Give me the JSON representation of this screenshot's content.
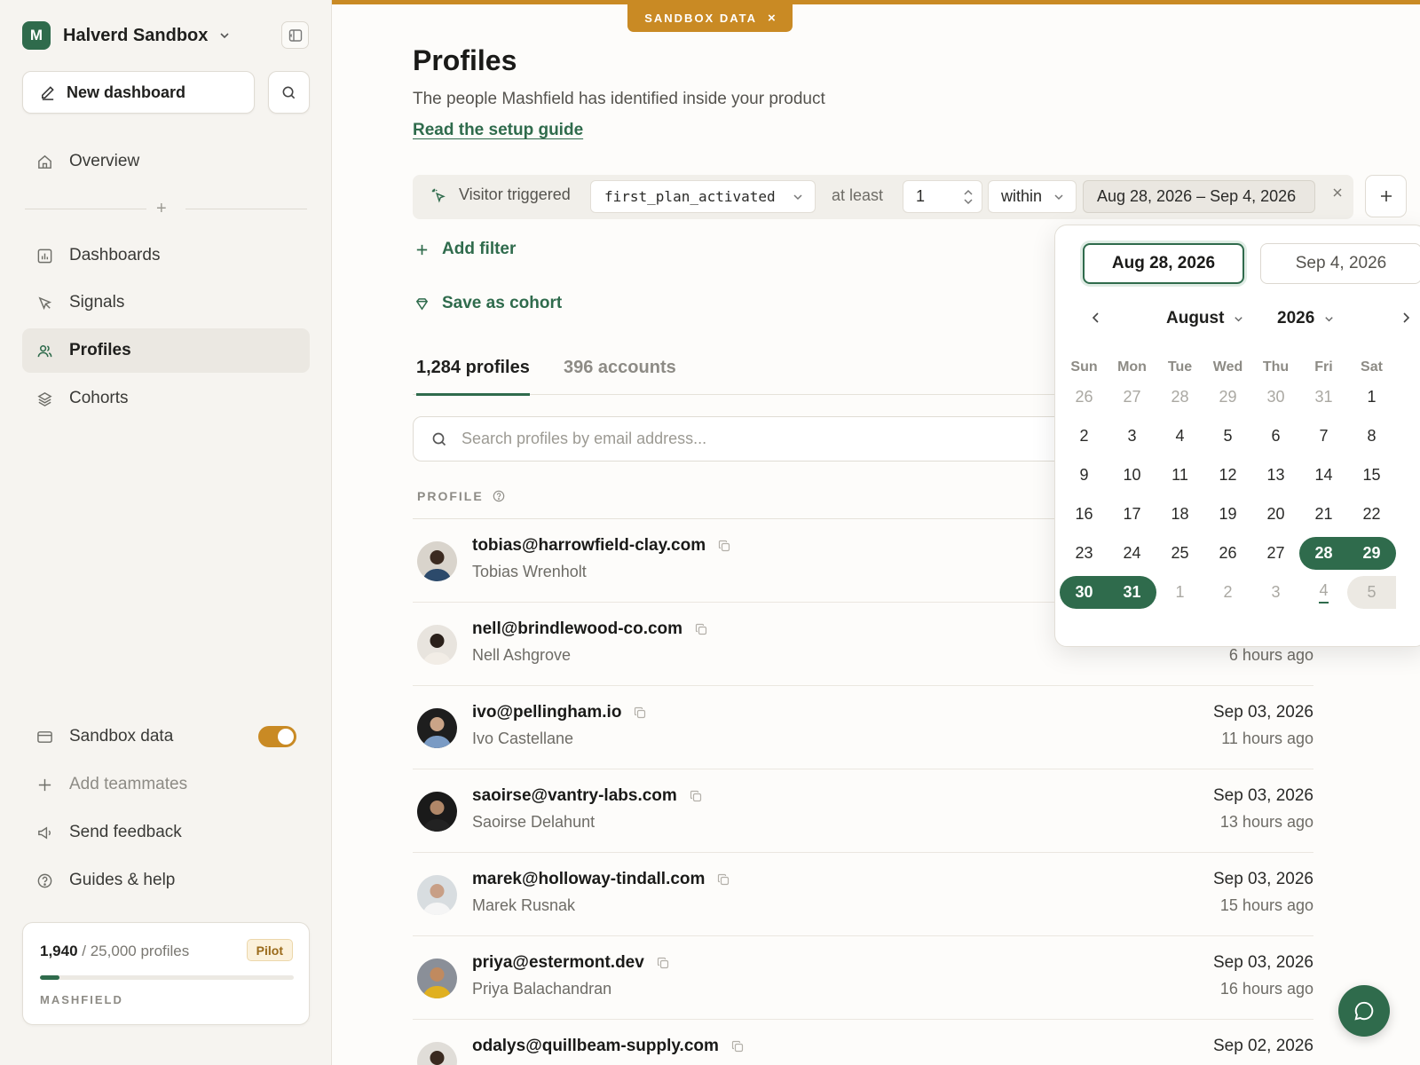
{
  "colors": {
    "brand": "#2f6b4c",
    "sandbox_accent": "#c98a24"
  },
  "workspace": {
    "initial": "M",
    "name": "Halverd Sandbox"
  },
  "sidebar": {
    "new_dashboard": "New dashboard",
    "nav": [
      {
        "label": "Overview",
        "icon": "home-icon"
      },
      {
        "label": "Dashboards",
        "icon": "chart-icon"
      },
      {
        "label": "Signals",
        "icon": "cursor-icon"
      },
      {
        "label": "Profiles",
        "icon": "users-icon",
        "active": true
      },
      {
        "label": "Cohorts",
        "icon": "layers-icon"
      }
    ],
    "bottom": [
      {
        "label": "Sandbox data",
        "icon": "card-icon",
        "toggle_on": true
      },
      {
        "label": "Add teammates",
        "icon": "plus-icon"
      },
      {
        "label": "Send feedback",
        "icon": "megaphone-icon"
      },
      {
        "label": "Guides & help",
        "icon": "help-icon"
      }
    ],
    "usage": {
      "used": "1,940",
      "total": "/ 25,000 profiles",
      "plan": "Pilot",
      "fraction": 0.0776,
      "org": "MASHFIELD"
    }
  },
  "banner": {
    "label": "SANDBOX DATA",
    "close": "×"
  },
  "page": {
    "title": "Profiles",
    "subtitle": "The people Mashfield has identified inside your product",
    "setup_link": "Read the setup guide"
  },
  "filter": {
    "trigger": "Visitor triggered",
    "event": "first_plan_activated",
    "at_least": "at least",
    "count": "1",
    "within": "within",
    "range": "Aug 28, 2026 – Sep 4, 2026"
  },
  "actions": {
    "add_filter": "Add filter",
    "save_cohort": "Save as cohort"
  },
  "tabs": {
    "profiles": "1,284 profiles",
    "accounts": "396 accounts"
  },
  "search": {
    "placeholder": "Search profiles by email address..."
  },
  "table": {
    "column": "PROFILE",
    "rows": [
      {
        "email": "tobias@harrowfield-clay.com",
        "name": "Tobias Wrenholt",
        "date": "",
        "ago": ""
      },
      {
        "email": "nell@brindlewood-co.com",
        "name": "Nell Ashgrove",
        "date": "",
        "ago": "6 hours ago"
      },
      {
        "email": "ivo@pellingham.io",
        "name": "Ivo Castellane",
        "date": "Sep 03, 2026",
        "ago": "11 hours ago"
      },
      {
        "email": "saoirse@vantry-labs.com",
        "name": "Saoirse Delahunt",
        "date": "Sep 03, 2026",
        "ago": "13 hours ago"
      },
      {
        "email": "marek@holloway-tindall.com",
        "name": "Marek Rusnak",
        "date": "Sep 03, 2026",
        "ago": "15 hours ago"
      },
      {
        "email": "priya@estermont.dev",
        "name": "Priya Balachandran",
        "date": "Sep 03, 2026",
        "ago": "16 hours ago"
      },
      {
        "email": "odalys@quillbeam-supply.com",
        "name": "",
        "date": "Sep 02, 2026",
        "ago": ""
      }
    ]
  },
  "calendar": {
    "start": "Aug 28, 2026",
    "end": "Sep 4, 2026",
    "month": "August",
    "year": "2026",
    "dow": [
      "Sun",
      "Mon",
      "Tue",
      "Wed",
      "Thu",
      "Fri",
      "Sat"
    ],
    "weeks": [
      [
        "26",
        "27",
        "28",
        "29",
        "30",
        "31",
        "1"
      ],
      [
        "2",
        "3",
        "4",
        "5",
        "6",
        "7",
        "8"
      ],
      [
        "9",
        "10",
        "11",
        "12",
        "13",
        "14",
        "15"
      ],
      [
        "16",
        "17",
        "18",
        "19",
        "20",
        "21",
        "22"
      ],
      [
        "23",
        "24",
        "25",
        "26",
        "27",
        "28",
        "29"
      ],
      [
        "30",
        "31",
        "1",
        "2",
        "3",
        "4",
        "5"
      ]
    ]
  }
}
